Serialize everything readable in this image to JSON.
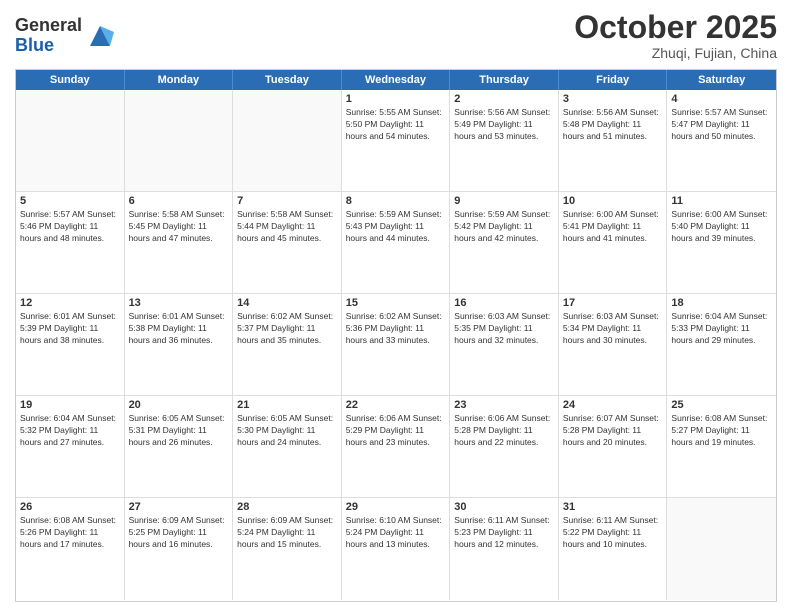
{
  "header": {
    "logo_general": "General",
    "logo_blue": "Blue",
    "month_title": "October 2025",
    "location": "Zhuqi, Fujian, China"
  },
  "weekdays": [
    "Sunday",
    "Monday",
    "Tuesday",
    "Wednesday",
    "Thursday",
    "Friday",
    "Saturday"
  ],
  "rows": [
    [
      {
        "day": "",
        "info": ""
      },
      {
        "day": "",
        "info": ""
      },
      {
        "day": "",
        "info": ""
      },
      {
        "day": "1",
        "info": "Sunrise: 5:55 AM\nSunset: 5:50 PM\nDaylight: 11 hours\nand 54 minutes."
      },
      {
        "day": "2",
        "info": "Sunrise: 5:56 AM\nSunset: 5:49 PM\nDaylight: 11 hours\nand 53 minutes."
      },
      {
        "day": "3",
        "info": "Sunrise: 5:56 AM\nSunset: 5:48 PM\nDaylight: 11 hours\nand 51 minutes."
      },
      {
        "day": "4",
        "info": "Sunrise: 5:57 AM\nSunset: 5:47 PM\nDaylight: 11 hours\nand 50 minutes."
      }
    ],
    [
      {
        "day": "5",
        "info": "Sunrise: 5:57 AM\nSunset: 5:46 PM\nDaylight: 11 hours\nand 48 minutes."
      },
      {
        "day": "6",
        "info": "Sunrise: 5:58 AM\nSunset: 5:45 PM\nDaylight: 11 hours\nand 47 minutes."
      },
      {
        "day": "7",
        "info": "Sunrise: 5:58 AM\nSunset: 5:44 PM\nDaylight: 11 hours\nand 45 minutes."
      },
      {
        "day": "8",
        "info": "Sunrise: 5:59 AM\nSunset: 5:43 PM\nDaylight: 11 hours\nand 44 minutes."
      },
      {
        "day": "9",
        "info": "Sunrise: 5:59 AM\nSunset: 5:42 PM\nDaylight: 11 hours\nand 42 minutes."
      },
      {
        "day": "10",
        "info": "Sunrise: 6:00 AM\nSunset: 5:41 PM\nDaylight: 11 hours\nand 41 minutes."
      },
      {
        "day": "11",
        "info": "Sunrise: 6:00 AM\nSunset: 5:40 PM\nDaylight: 11 hours\nand 39 minutes."
      }
    ],
    [
      {
        "day": "12",
        "info": "Sunrise: 6:01 AM\nSunset: 5:39 PM\nDaylight: 11 hours\nand 38 minutes."
      },
      {
        "day": "13",
        "info": "Sunrise: 6:01 AM\nSunset: 5:38 PM\nDaylight: 11 hours\nand 36 minutes."
      },
      {
        "day": "14",
        "info": "Sunrise: 6:02 AM\nSunset: 5:37 PM\nDaylight: 11 hours\nand 35 minutes."
      },
      {
        "day": "15",
        "info": "Sunrise: 6:02 AM\nSunset: 5:36 PM\nDaylight: 11 hours\nand 33 minutes."
      },
      {
        "day": "16",
        "info": "Sunrise: 6:03 AM\nSunset: 5:35 PM\nDaylight: 11 hours\nand 32 minutes."
      },
      {
        "day": "17",
        "info": "Sunrise: 6:03 AM\nSunset: 5:34 PM\nDaylight: 11 hours\nand 30 minutes."
      },
      {
        "day": "18",
        "info": "Sunrise: 6:04 AM\nSunset: 5:33 PM\nDaylight: 11 hours\nand 29 minutes."
      }
    ],
    [
      {
        "day": "19",
        "info": "Sunrise: 6:04 AM\nSunset: 5:32 PM\nDaylight: 11 hours\nand 27 minutes."
      },
      {
        "day": "20",
        "info": "Sunrise: 6:05 AM\nSunset: 5:31 PM\nDaylight: 11 hours\nand 26 minutes."
      },
      {
        "day": "21",
        "info": "Sunrise: 6:05 AM\nSunset: 5:30 PM\nDaylight: 11 hours\nand 24 minutes."
      },
      {
        "day": "22",
        "info": "Sunrise: 6:06 AM\nSunset: 5:29 PM\nDaylight: 11 hours\nand 23 minutes."
      },
      {
        "day": "23",
        "info": "Sunrise: 6:06 AM\nSunset: 5:28 PM\nDaylight: 11 hours\nand 22 minutes."
      },
      {
        "day": "24",
        "info": "Sunrise: 6:07 AM\nSunset: 5:28 PM\nDaylight: 11 hours\nand 20 minutes."
      },
      {
        "day": "25",
        "info": "Sunrise: 6:08 AM\nSunset: 5:27 PM\nDaylight: 11 hours\nand 19 minutes."
      }
    ],
    [
      {
        "day": "26",
        "info": "Sunrise: 6:08 AM\nSunset: 5:26 PM\nDaylight: 11 hours\nand 17 minutes."
      },
      {
        "day": "27",
        "info": "Sunrise: 6:09 AM\nSunset: 5:25 PM\nDaylight: 11 hours\nand 16 minutes."
      },
      {
        "day": "28",
        "info": "Sunrise: 6:09 AM\nSunset: 5:24 PM\nDaylight: 11 hours\nand 15 minutes."
      },
      {
        "day": "29",
        "info": "Sunrise: 6:10 AM\nSunset: 5:24 PM\nDaylight: 11 hours\nand 13 minutes."
      },
      {
        "day": "30",
        "info": "Sunrise: 6:11 AM\nSunset: 5:23 PM\nDaylight: 11 hours\nand 12 minutes."
      },
      {
        "day": "31",
        "info": "Sunrise: 6:11 AM\nSunset: 5:22 PM\nDaylight: 11 hours\nand 10 minutes."
      },
      {
        "day": "",
        "info": ""
      }
    ]
  ]
}
